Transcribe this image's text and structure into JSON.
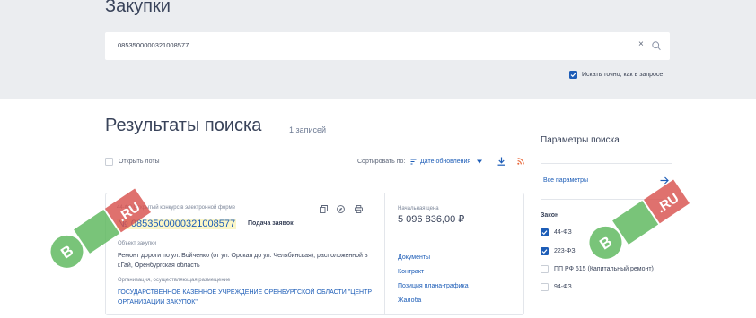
{
  "header": {
    "title": "Закупки",
    "search_value": "0853500000321008577",
    "clear_symbol": "×",
    "exact_label": "Искать точно, как в запросе",
    "exact_checked": true
  },
  "results": {
    "title": "Результаты поиска",
    "count": "1 записей",
    "open_lots_label": "Открыть лоты",
    "sort_label": "Сортировать по:",
    "sort_value": "Дате обновления"
  },
  "card": {
    "purchase_type": "44-ФЗ Открытый конкурс в электронной форме",
    "number": "№ 0853500000321008577",
    "stage": "Подача заявок",
    "object_caption": "Объект закупки",
    "object_text": "Ремонт дороги по ул. Войченко (от ул. Орская до ул. Челябинская), расположенной в г.Гай, Оренбургская область",
    "org_caption": "Организация, осуществляющая размещение",
    "org_text": "ГОСУДАРСТВЕННОЕ КАЗЕННОЕ УЧРЕЖДЕНИЕ ОРЕНБУРГСКОЙ ОБЛАСТИ \"ЦЕНТР ОРГАНИЗАЦИИ ЗАКУПОК\"",
    "price_caption": "Начальная цена",
    "price": "5 096 836,00 ₽",
    "links": [
      "Документы",
      "Контракт",
      "Позиция плана-графика",
      "Жалоба"
    ]
  },
  "params": {
    "title": "Параметры поиска",
    "all_params": "Все параметры",
    "law_title": "Закон",
    "laws": [
      {
        "label": "44-ФЗ",
        "checked": true
      },
      {
        "label": "223-ФЗ",
        "checked": true
      },
      {
        "label": "ПП РФ 615 (Капитальный ремонт)",
        "checked": false
      },
      {
        "label": "94-ФЗ",
        "checked": false
      }
    ]
  },
  "watermark": {
    "text": "ГОСЗАКУПКИ.RU",
    "colors": {
      "green": "#5cb85c",
      "red": "#d9534f"
    }
  },
  "colors": {
    "accent": "#1d5db7",
    "header_bg": "#ebedf0",
    "highlight": "#fbf6c7"
  }
}
